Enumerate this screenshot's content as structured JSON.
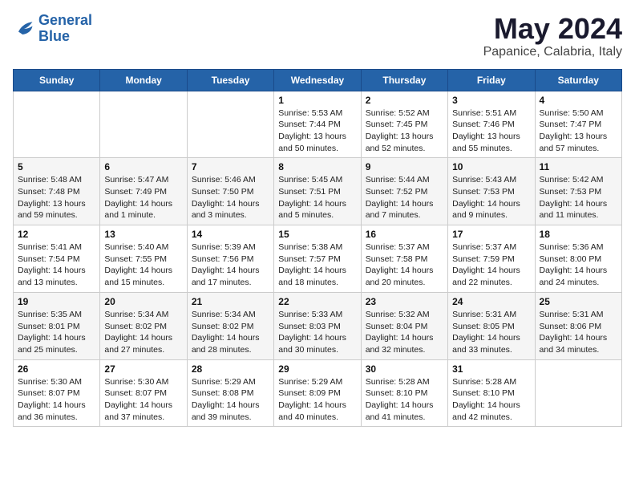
{
  "logo": {
    "line1": "General",
    "line2": "Blue"
  },
  "title": "May 2024",
  "location": "Papanice, Calabria, Italy",
  "days_header": [
    "Sunday",
    "Monday",
    "Tuesday",
    "Wednesday",
    "Thursday",
    "Friday",
    "Saturday"
  ],
  "weeks": [
    [
      {
        "day": "",
        "sunrise": "",
        "sunset": "",
        "daylight": ""
      },
      {
        "day": "",
        "sunrise": "",
        "sunset": "",
        "daylight": ""
      },
      {
        "day": "",
        "sunrise": "",
        "sunset": "",
        "daylight": ""
      },
      {
        "day": "1",
        "sunrise": "Sunrise: 5:53 AM",
        "sunset": "Sunset: 7:44 PM",
        "daylight": "Daylight: 13 hours and 50 minutes."
      },
      {
        "day": "2",
        "sunrise": "Sunrise: 5:52 AM",
        "sunset": "Sunset: 7:45 PM",
        "daylight": "Daylight: 13 hours and 52 minutes."
      },
      {
        "day": "3",
        "sunrise": "Sunrise: 5:51 AM",
        "sunset": "Sunset: 7:46 PM",
        "daylight": "Daylight: 13 hours and 55 minutes."
      },
      {
        "day": "4",
        "sunrise": "Sunrise: 5:50 AM",
        "sunset": "Sunset: 7:47 PM",
        "daylight": "Daylight: 13 hours and 57 minutes."
      }
    ],
    [
      {
        "day": "5",
        "sunrise": "Sunrise: 5:48 AM",
        "sunset": "Sunset: 7:48 PM",
        "daylight": "Daylight: 13 hours and 59 minutes."
      },
      {
        "day": "6",
        "sunrise": "Sunrise: 5:47 AM",
        "sunset": "Sunset: 7:49 PM",
        "daylight": "Daylight: 14 hours and 1 minute."
      },
      {
        "day": "7",
        "sunrise": "Sunrise: 5:46 AM",
        "sunset": "Sunset: 7:50 PM",
        "daylight": "Daylight: 14 hours and 3 minutes."
      },
      {
        "day": "8",
        "sunrise": "Sunrise: 5:45 AM",
        "sunset": "Sunset: 7:51 PM",
        "daylight": "Daylight: 14 hours and 5 minutes."
      },
      {
        "day": "9",
        "sunrise": "Sunrise: 5:44 AM",
        "sunset": "Sunset: 7:52 PM",
        "daylight": "Daylight: 14 hours and 7 minutes."
      },
      {
        "day": "10",
        "sunrise": "Sunrise: 5:43 AM",
        "sunset": "Sunset: 7:53 PM",
        "daylight": "Daylight: 14 hours and 9 minutes."
      },
      {
        "day": "11",
        "sunrise": "Sunrise: 5:42 AM",
        "sunset": "Sunset: 7:53 PM",
        "daylight": "Daylight: 14 hours and 11 minutes."
      }
    ],
    [
      {
        "day": "12",
        "sunrise": "Sunrise: 5:41 AM",
        "sunset": "Sunset: 7:54 PM",
        "daylight": "Daylight: 14 hours and 13 minutes."
      },
      {
        "day": "13",
        "sunrise": "Sunrise: 5:40 AM",
        "sunset": "Sunset: 7:55 PM",
        "daylight": "Daylight: 14 hours and 15 minutes."
      },
      {
        "day": "14",
        "sunrise": "Sunrise: 5:39 AM",
        "sunset": "Sunset: 7:56 PM",
        "daylight": "Daylight: 14 hours and 17 minutes."
      },
      {
        "day": "15",
        "sunrise": "Sunrise: 5:38 AM",
        "sunset": "Sunset: 7:57 PM",
        "daylight": "Daylight: 14 hours and 18 minutes."
      },
      {
        "day": "16",
        "sunrise": "Sunrise: 5:37 AM",
        "sunset": "Sunset: 7:58 PM",
        "daylight": "Daylight: 14 hours and 20 minutes."
      },
      {
        "day": "17",
        "sunrise": "Sunrise: 5:37 AM",
        "sunset": "Sunset: 7:59 PM",
        "daylight": "Daylight: 14 hours and 22 minutes."
      },
      {
        "day": "18",
        "sunrise": "Sunrise: 5:36 AM",
        "sunset": "Sunset: 8:00 PM",
        "daylight": "Daylight: 14 hours and 24 minutes."
      }
    ],
    [
      {
        "day": "19",
        "sunrise": "Sunrise: 5:35 AM",
        "sunset": "Sunset: 8:01 PM",
        "daylight": "Daylight: 14 hours and 25 minutes."
      },
      {
        "day": "20",
        "sunrise": "Sunrise: 5:34 AM",
        "sunset": "Sunset: 8:02 PM",
        "daylight": "Daylight: 14 hours and 27 minutes."
      },
      {
        "day": "21",
        "sunrise": "Sunrise: 5:34 AM",
        "sunset": "Sunset: 8:02 PM",
        "daylight": "Daylight: 14 hours and 28 minutes."
      },
      {
        "day": "22",
        "sunrise": "Sunrise: 5:33 AM",
        "sunset": "Sunset: 8:03 PM",
        "daylight": "Daylight: 14 hours and 30 minutes."
      },
      {
        "day": "23",
        "sunrise": "Sunrise: 5:32 AM",
        "sunset": "Sunset: 8:04 PM",
        "daylight": "Daylight: 14 hours and 32 minutes."
      },
      {
        "day": "24",
        "sunrise": "Sunrise: 5:31 AM",
        "sunset": "Sunset: 8:05 PM",
        "daylight": "Daylight: 14 hours and 33 minutes."
      },
      {
        "day": "25",
        "sunrise": "Sunrise: 5:31 AM",
        "sunset": "Sunset: 8:06 PM",
        "daylight": "Daylight: 14 hours and 34 minutes."
      }
    ],
    [
      {
        "day": "26",
        "sunrise": "Sunrise: 5:30 AM",
        "sunset": "Sunset: 8:07 PM",
        "daylight": "Daylight: 14 hours and 36 minutes."
      },
      {
        "day": "27",
        "sunrise": "Sunrise: 5:30 AM",
        "sunset": "Sunset: 8:07 PM",
        "daylight": "Daylight: 14 hours and 37 minutes."
      },
      {
        "day": "28",
        "sunrise": "Sunrise: 5:29 AM",
        "sunset": "Sunset: 8:08 PM",
        "daylight": "Daylight: 14 hours and 39 minutes."
      },
      {
        "day": "29",
        "sunrise": "Sunrise: 5:29 AM",
        "sunset": "Sunset: 8:09 PM",
        "daylight": "Daylight: 14 hours and 40 minutes."
      },
      {
        "day": "30",
        "sunrise": "Sunrise: 5:28 AM",
        "sunset": "Sunset: 8:10 PM",
        "daylight": "Daylight: 14 hours and 41 minutes."
      },
      {
        "day": "31",
        "sunrise": "Sunrise: 5:28 AM",
        "sunset": "Sunset: 8:10 PM",
        "daylight": "Daylight: 14 hours and 42 minutes."
      },
      {
        "day": "",
        "sunrise": "",
        "sunset": "",
        "daylight": ""
      }
    ]
  ]
}
